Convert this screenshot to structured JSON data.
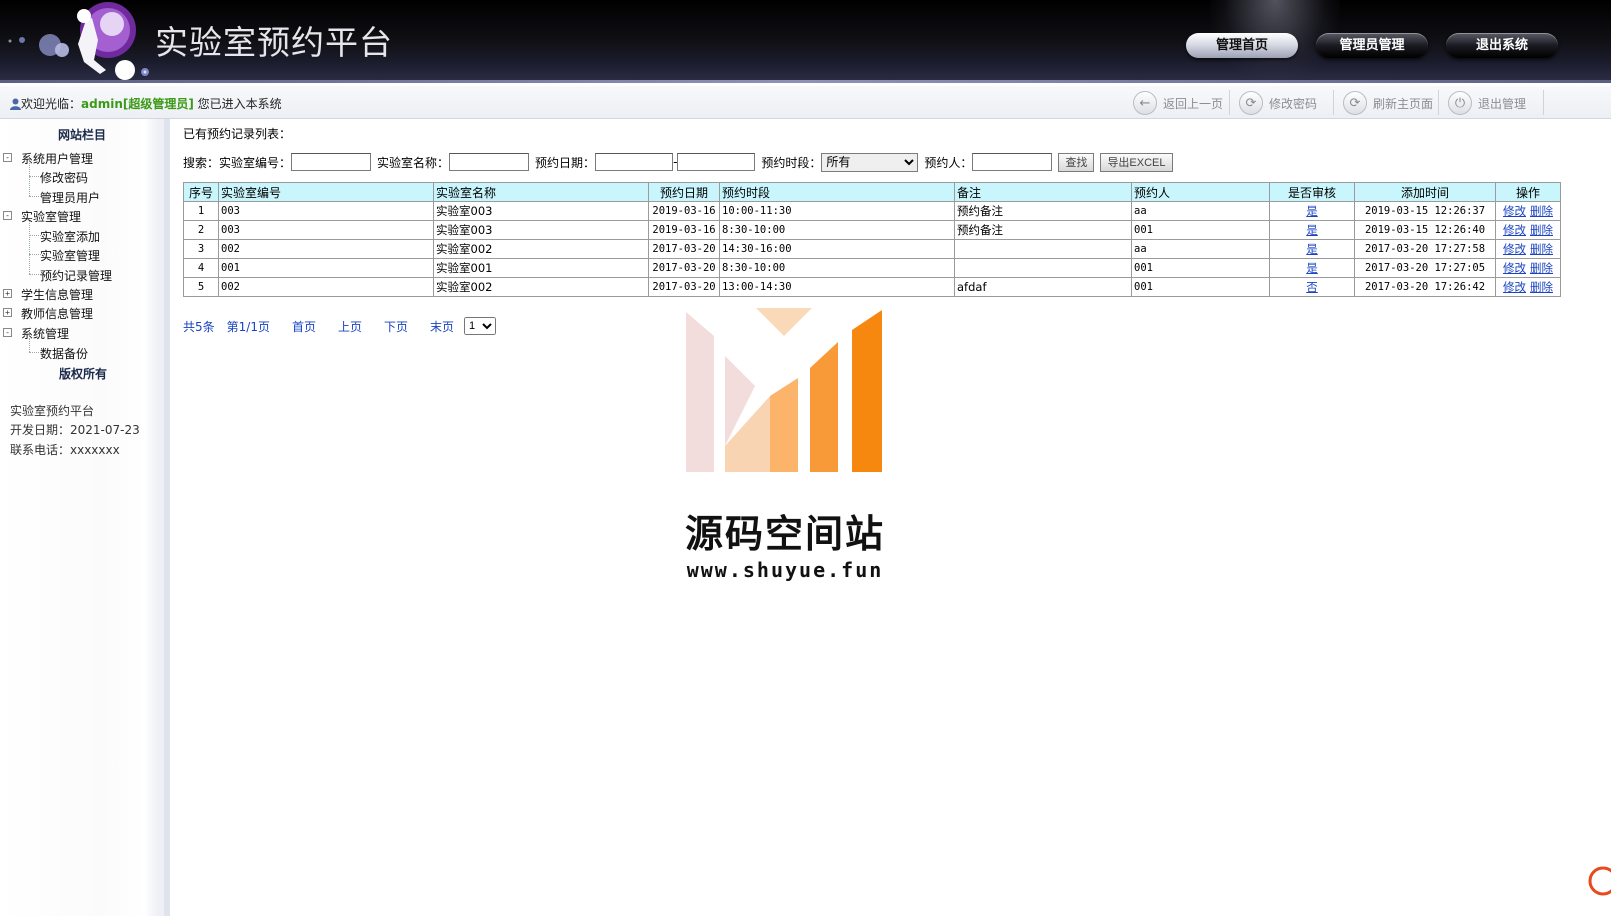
{
  "header": {
    "site_title": "实验室预约平台",
    "nav": [
      "管理首页",
      "管理员管理",
      "退出系统"
    ]
  },
  "infobar": {
    "welcome_prefix": "欢迎光临：",
    "user": "admin[超级管理员]",
    "welcome_suffix": " 您已进入本系统",
    "tools": [
      "返回上一页",
      "修改密码",
      "刷新主页面",
      "退出管理"
    ]
  },
  "sidebar": {
    "title": "网站栏目",
    "groups": [
      {
        "label": "系统用户管理",
        "items": [
          "修改密码",
          "管理员用户"
        ]
      },
      {
        "label": "实验室管理",
        "items": [
          "实验室添加",
          "实验室管理",
          "预约记录管理"
        ]
      },
      {
        "label": "学生信息管理",
        "items": []
      },
      {
        "label": "教师信息管理",
        "items": []
      },
      {
        "label": "系统管理",
        "items": [
          "数据备份"
        ]
      }
    ],
    "copyright_title": "版权所有",
    "info": [
      "实验室预约平台",
      "开发日期：2021-07-23",
      "联系电话：xxxxxxx"
    ]
  },
  "main": {
    "list_title": "已有预约记录列表：",
    "search": {
      "prefix": "搜索：",
      "lab_no_label": "实验室编号：",
      "lab_name_label": "实验室名称：",
      "date_label": "预约日期：",
      "date_sep": "-",
      "period_label": "预约时段：",
      "period_selected": "所有",
      "person_label": "预约人：",
      "search_btn": "查找",
      "export_btn": "导出EXCEL"
    },
    "columns": [
      "序号",
      "实验室编号",
      "实验室名称",
      "预约日期",
      "预约时段",
      "备注",
      "预约人",
      "是否审核",
      "添加时间",
      "操作"
    ],
    "rows": [
      {
        "no": "1",
        "lab_no": "003",
        "lab_name": "实验室003",
        "date": "2019-03-16",
        "period": "10:00-11:30",
        "remark": "预约备注",
        "person": "aa",
        "audited": "是",
        "added": "2019-03-15 12:26:37"
      },
      {
        "no": "2",
        "lab_no": "003",
        "lab_name": "实验室003",
        "date": "2019-03-16",
        "period": "8:30-10:00",
        "remark": "预约备注",
        "person": "001",
        "audited": "是",
        "added": "2019-03-15 12:26:40"
      },
      {
        "no": "3",
        "lab_no": "002",
        "lab_name": "实验室002",
        "date": "2017-03-20",
        "period": "14:30-16:00",
        "remark": "",
        "person": "aa",
        "audited": "是",
        "added": "2017-03-20 17:27:58"
      },
      {
        "no": "4",
        "lab_no": "001",
        "lab_name": "实验室001",
        "date": "2017-03-20",
        "period": "8:30-10:00",
        "remark": "",
        "person": "001",
        "audited": "是",
        "added": "2017-03-20 17:27:05"
      },
      {
        "no": "5",
        "lab_no": "002",
        "lab_name": "实验室002",
        "date": "2017-03-20",
        "period": "13:00-14:30",
        "remark": "afdaf",
        "person": "001",
        "audited": "否",
        "added": "2017-03-20 17:26:42"
      }
    ],
    "actions": {
      "edit": "修改",
      "delete": "删除"
    },
    "pager": {
      "total": "共5条",
      "page": "第1/1页",
      "first": "首页",
      "prev": "上页",
      "next": "下页",
      "last": "末页",
      "page_select": "1"
    }
  },
  "watermark": {
    "text": "源码空间站",
    "url": "www.shuyue.fun"
  },
  "colors": {
    "header_dark": "#000000",
    "table_header": "#c9f5fc",
    "link": "#1a44c2",
    "user_green": "#3d9a17",
    "watermark_orange": "#f7880f"
  }
}
